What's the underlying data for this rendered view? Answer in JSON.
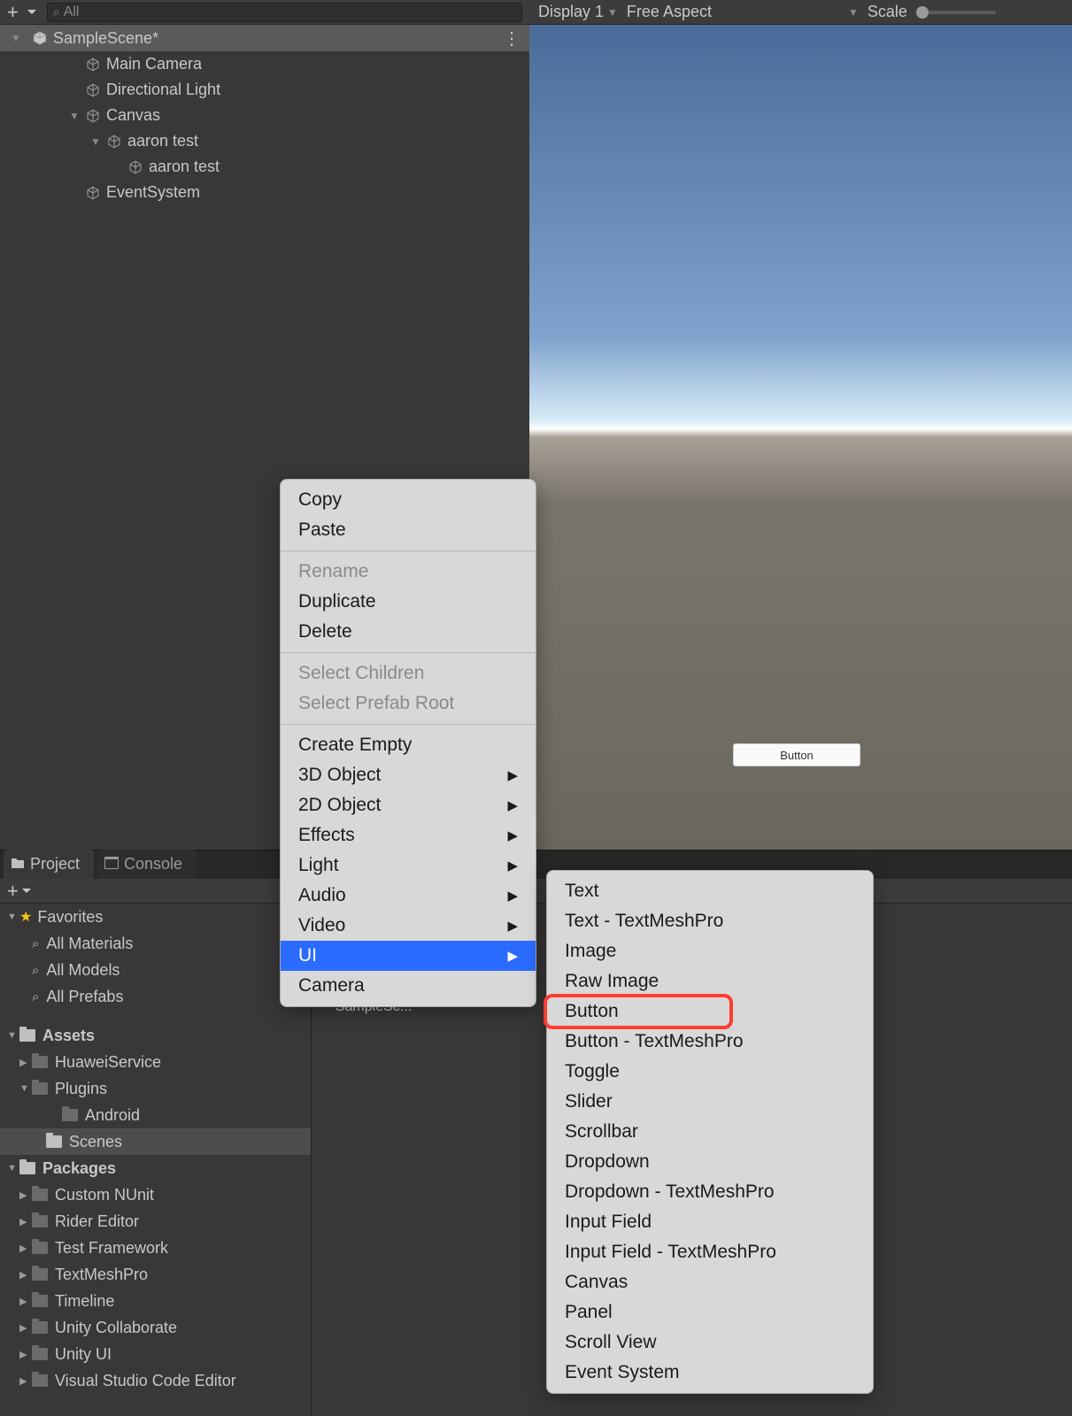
{
  "hierarchy": {
    "search_text": "All",
    "scene_name": "SampleScene*",
    "items": [
      {
        "label": "Main Camera",
        "indent": 96
      },
      {
        "label": "Directional Light",
        "indent": 96
      },
      {
        "label": "Canvas",
        "indent": 96,
        "expanded": true,
        "has_children": true
      },
      {
        "label": "aaron test",
        "indent": 120,
        "expanded": true,
        "has_children": true
      },
      {
        "label": "aaron test",
        "indent": 144
      },
      {
        "label": "EventSystem",
        "indent": 96
      }
    ]
  },
  "game": {
    "display": "Display 1",
    "aspect": "Free Aspect",
    "scale_label": "Scale",
    "button_label": "Button"
  },
  "context_menu": {
    "items": [
      {
        "label": "Copy",
        "type": "item"
      },
      {
        "label": "Paste",
        "type": "item"
      },
      {
        "type": "sep"
      },
      {
        "label": "Rename",
        "type": "item",
        "disabled": true
      },
      {
        "label": "Duplicate",
        "type": "item"
      },
      {
        "label": "Delete",
        "type": "item"
      },
      {
        "type": "sep"
      },
      {
        "label": "Select Children",
        "type": "item",
        "disabled": true
      },
      {
        "label": "Select Prefab Root",
        "type": "item",
        "disabled": true
      },
      {
        "type": "sep"
      },
      {
        "label": "Create Empty",
        "type": "item"
      },
      {
        "label": "3D Object",
        "type": "item",
        "submenu": true
      },
      {
        "label": "2D Object",
        "type": "item",
        "submenu": true
      },
      {
        "label": "Effects",
        "type": "item",
        "submenu": true
      },
      {
        "label": "Light",
        "type": "item",
        "submenu": true
      },
      {
        "label": "Audio",
        "type": "item",
        "submenu": true
      },
      {
        "label": "Video",
        "type": "item",
        "submenu": true
      },
      {
        "label": "UI",
        "type": "item",
        "submenu": true,
        "highlighted": true
      },
      {
        "label": "Camera",
        "type": "item"
      }
    ]
  },
  "submenu": {
    "items": [
      "Text",
      "Text - TextMeshPro",
      "Image",
      "Raw Image",
      "Button",
      "Button - TextMeshPro",
      "Toggle",
      "Slider",
      "Scrollbar",
      "Dropdown",
      "Dropdown - TextMeshPro",
      "Input Field",
      "Input Field - TextMeshPro",
      "Canvas",
      "Panel",
      "Scroll View",
      "Event System"
    ],
    "highlighted_index": 4
  },
  "bottom_tabs": {
    "project": "Project",
    "console": "Console"
  },
  "project": {
    "favorites_label": "Favorites",
    "favorites": [
      "All Materials",
      "All Models",
      "All Prefabs"
    ],
    "assets_label": "Assets",
    "assets_tree": [
      {
        "label": "HuaweiService",
        "indent": 28,
        "has_children": true
      },
      {
        "label": "Plugins",
        "indent": 28,
        "has_children": true,
        "expanded": true
      },
      {
        "label": "Android",
        "indent": 62
      },
      {
        "label": "Scenes",
        "indent": 44,
        "selected": true
      }
    ],
    "packages_label": "Packages",
    "packages": [
      "Custom NUnit",
      "Rider Editor",
      "Test Framework",
      "TextMeshPro",
      "Timeline",
      "Unity Collaborate",
      "Unity UI",
      "Visual Studio Code Editor"
    ],
    "asset_thumb": "SampleSc..."
  }
}
